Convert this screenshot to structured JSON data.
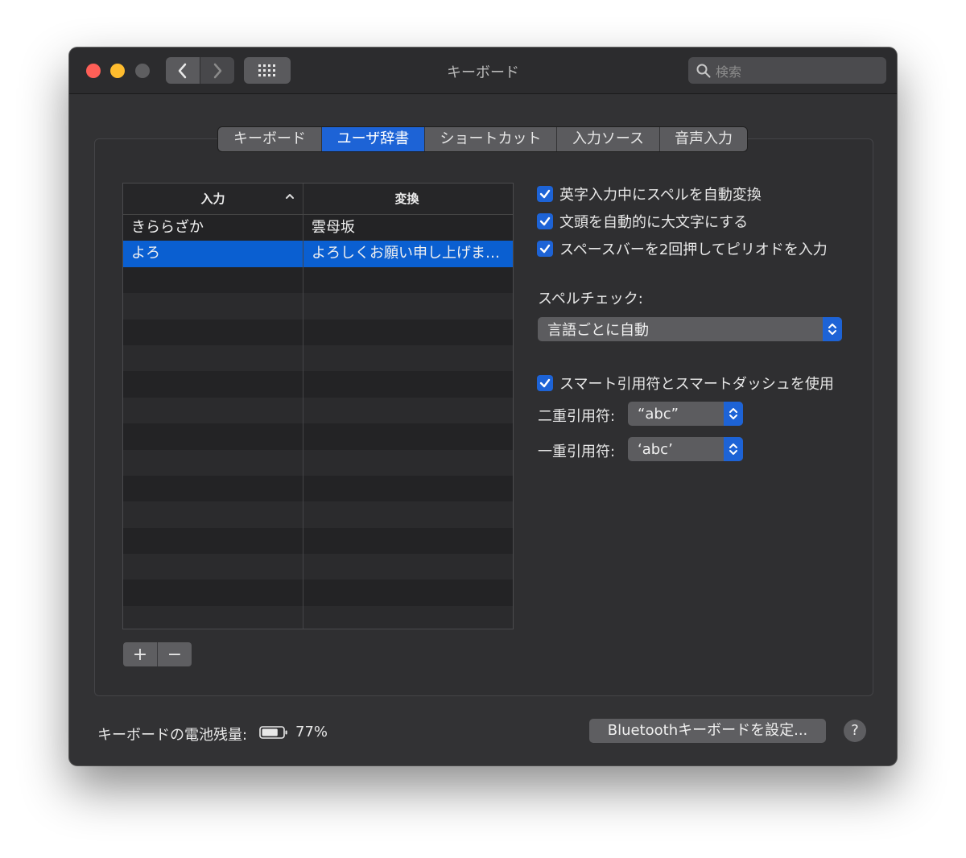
{
  "window": {
    "title": "キーボード"
  },
  "search": {
    "placeholder": "検索"
  },
  "tabs": [
    {
      "label": "キーボード",
      "active": false
    },
    {
      "label": "ユーザ辞書",
      "active": true
    },
    {
      "label": "ショートカット",
      "active": false
    },
    {
      "label": "入力ソース",
      "active": false
    },
    {
      "label": "音声入力",
      "active": false
    }
  ],
  "dictionary": {
    "columns": {
      "input": "入力",
      "conversion": "変換"
    },
    "rows": [
      {
        "input": "きららざか",
        "conversion": "雲母坂",
        "selected": false
      },
      {
        "input": "よろ",
        "conversion": "よろしくお願い申し上げま…",
        "selected": true
      }
    ],
    "add_label": "+",
    "remove_label": "−"
  },
  "options": {
    "autocorrect": {
      "label": "英字入力中にスペルを自動変換",
      "checked": true
    },
    "capitalize": {
      "label": "文頭を自動的に大文字にする",
      "checked": true
    },
    "period": {
      "label": "スペースバーを2回押してピリオドを入力",
      "checked": true
    },
    "spellcheck_label": "スペルチェック:",
    "spellcheck_value": "言語ごとに自動",
    "smart_quotes": {
      "label": "スマート引用符とスマートダッシュを使用",
      "checked": true
    },
    "double_quote_label": "二重引用符:",
    "double_quote_value": "“abc”",
    "single_quote_label": "一重引用符:",
    "single_quote_value": "‘abc’"
  },
  "footer": {
    "battery_label": "キーボードの電池残量:",
    "battery_level": 0.77,
    "battery_percent": "77%",
    "bluetooth_button": "Bluetoothキーボードを設定...",
    "help_label": "?"
  },
  "colors": {
    "accent": "#1d63d6",
    "background": "#323234",
    "selected_row": "#0a5fd1"
  },
  "icons": {
    "back": "chevron-left-icon",
    "forward": "chevron-right-icon",
    "grid": "grid-icon",
    "search": "magnifier-icon",
    "battery": "battery-icon",
    "check": "checkmark-icon",
    "stepper": "up-down-chevron-icon",
    "help": "question-mark-icon"
  }
}
